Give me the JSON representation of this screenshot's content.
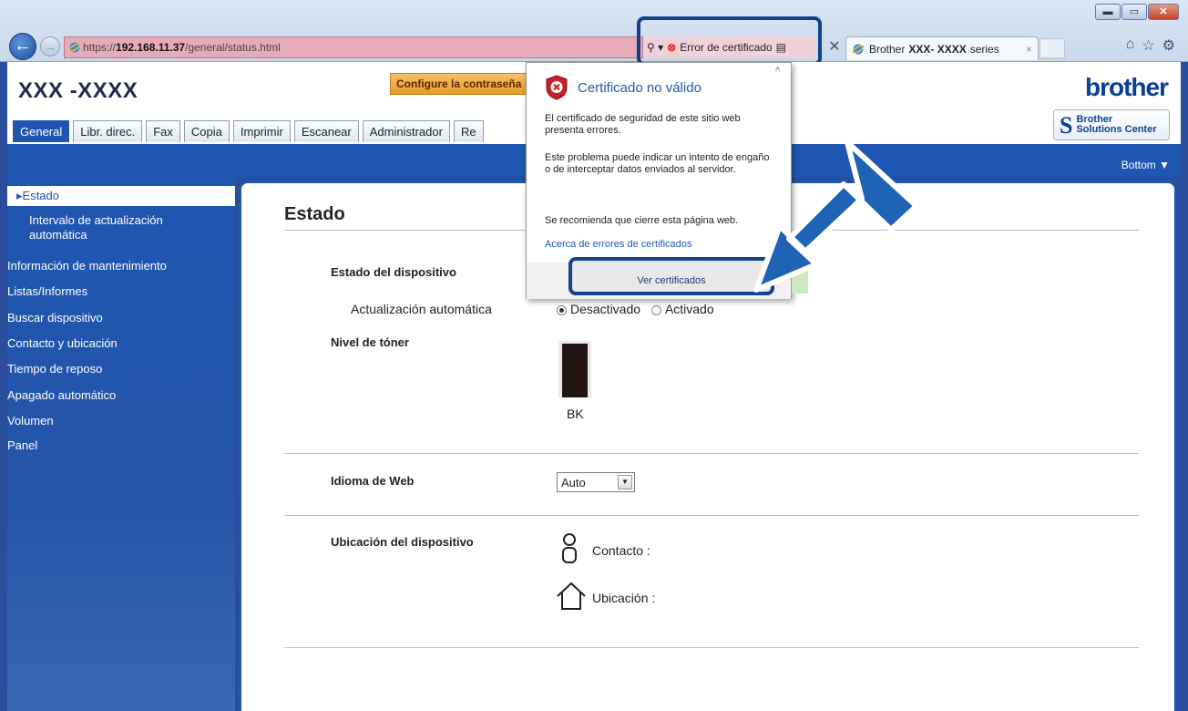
{
  "browser": {
    "url_prefix": "https://",
    "url_host": "192.168.11.37",
    "url_path": "/general/status.html",
    "search_glyph": "⚲ ▾",
    "cert_error_label": "Error de certificado",
    "cert_icon": "⊗",
    "lock_icon": "▤",
    "tab_title_prefix": "Brother",
    "tab_title_model": "XXX- XXXX",
    "tab_title_suffix": "series",
    "tab_close": "×",
    "home_icon": "⌂",
    "fav_icon": "☆",
    "gear_icon": "⚙",
    "window_min": "▬",
    "window_max": "▭",
    "window_close": "✕"
  },
  "header": {
    "model": "XXX -XXXX",
    "password_button": "Configure la contraseña",
    "logo": "brother",
    "solutions_line1": "Brother",
    "solutions_line2": "Solutions Center"
  },
  "tabs": [
    {
      "label": "General",
      "active": true
    },
    {
      "label": "Libr. direc."
    },
    {
      "label": "Fax"
    },
    {
      "label": "Copia"
    },
    {
      "label": "Imprimir"
    },
    {
      "label": "Escanear"
    },
    {
      "label": "Administrador"
    },
    {
      "label": "Re"
    }
  ],
  "bottom_link": "Bottom ▼",
  "sidebar": {
    "items": [
      "▸Estado",
      "Intervalo de actualización",
      "automática",
      "Información de mantenimiento",
      "Listas/Informes",
      "Buscar dispositivo",
      "Contacto y ubicación",
      "Tiempo de reposo",
      "Apagado automático",
      "Volumen",
      "Panel"
    ]
  },
  "main": {
    "title": "Estado",
    "device_status_label": "Estado del dispositivo",
    "auto_update_label": "Actualización automática",
    "radio_off": "Desactivado",
    "radio_on": "Activado",
    "auto_update_selected": "Desactivado",
    "toner_label": "Nivel de tóner",
    "toner_color": "BK",
    "toner_level": 0.95,
    "language_label": "Idioma de Web",
    "language_value": "Auto",
    "location_label": "Ubicación del dispositivo",
    "contact_label": "Contacto :",
    "location_field_label": "Ubicación :"
  },
  "popup": {
    "title": "Certificado no válido",
    "p1": "El certificado de seguridad de este sitio web presenta errores.",
    "p2": "Este problema puede indicar un intento de engaño o de interceptar datos enviados al servidor.",
    "p3": "Se recomienda que cierre esta página web.",
    "link": "Acerca de errores de certificados",
    "button": "Ver certificados",
    "caret": "^"
  },
  "colors": {
    "accent": "#1f56b1",
    "highlight": "#11428c",
    "cert_error_bg": "#f0d1d9",
    "address_bg": "#e7aab8"
  }
}
